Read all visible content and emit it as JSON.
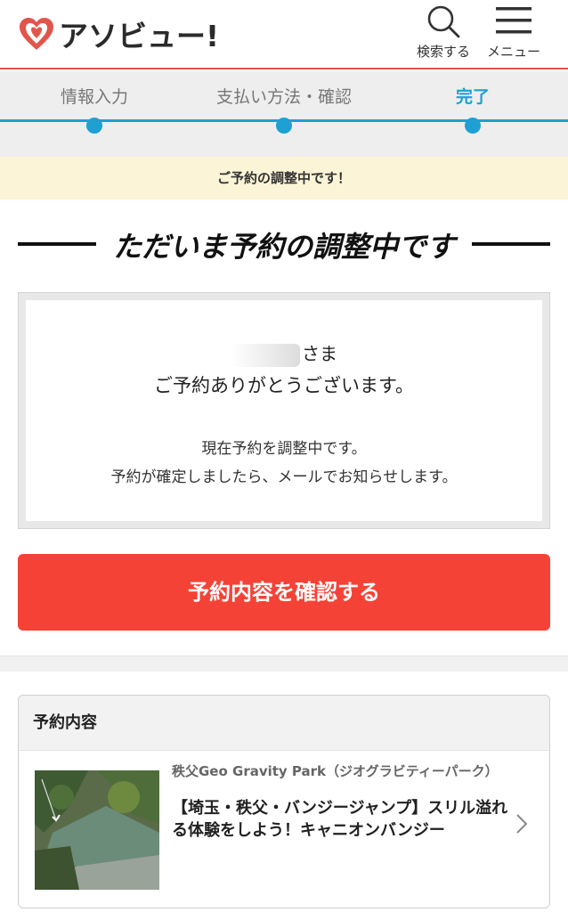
{
  "header": {
    "brand": "アソビュー!",
    "search_label": "検索する",
    "menu_label": "メニュー",
    "logo_color": "#e2554a"
  },
  "steps": [
    {
      "label": "情報入力",
      "active": false
    },
    {
      "label": "支払い方法・確認",
      "active": false
    },
    {
      "label": "完了",
      "active": true
    }
  ],
  "colors": {
    "accent": "#1ea0d2",
    "cta": "#f44336",
    "notice_bg": "#fcf4d6"
  },
  "notice": "ご予約の調整中です！",
  "heading": "ただいま予約の調整中です",
  "message": {
    "honorific": "さま",
    "thanks": "ご予約ありがとうございます。",
    "line1": "現在予約を調整中です。",
    "line2": "予約が確定しましたら、メールでお知らせします。"
  },
  "cta_label": "予約内容を確認する",
  "booking": {
    "section_title": "予約内容",
    "place": "秩父Geo Gravity Park（ジオグラビティーパーク）",
    "title": "【埼玉・秩父・バンジージャンプ】スリル溢れる体験をしよう！キャニオンバンジー"
  }
}
